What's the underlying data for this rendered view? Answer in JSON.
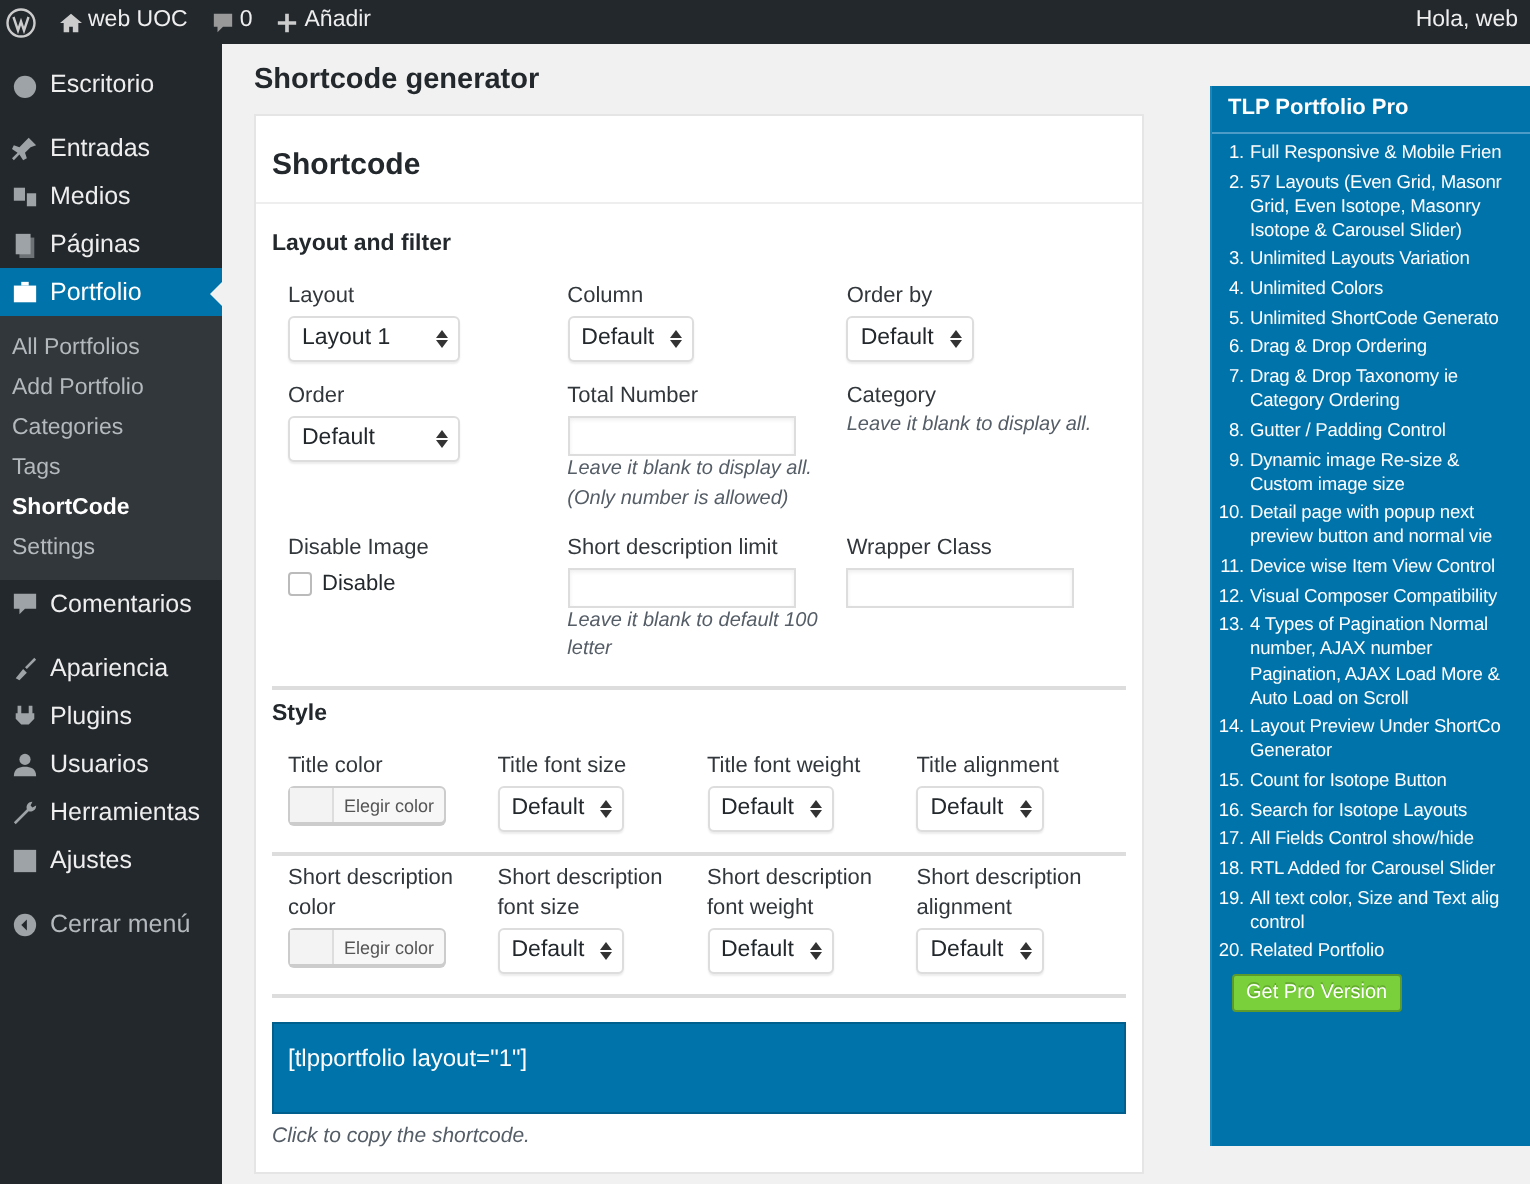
{
  "admin_bar": {
    "site": "web UOC",
    "comments": "0",
    "new": "Añadir",
    "greeting": "Hola, web"
  },
  "sidebar": {
    "groups": [
      [
        {
          "label": "Escritorio",
          "selected": false
        }
      ],
      [
        {
          "label": "Entradas",
          "selected": false
        },
        {
          "label": "Medios",
          "selected": false
        },
        {
          "label": "Páginas",
          "selected": false
        },
        {
          "label": "Portfolio",
          "selected": true,
          "children": [
            {
              "label": "All Portfolios",
              "selected": false
            },
            {
              "label": "Add Portfolio",
              "selected": false
            },
            {
              "label": "Categories",
              "selected": false
            },
            {
              "label": "Tags",
              "selected": false
            },
            {
              "label": "ShortCode",
              "selected": true
            },
            {
              "label": "Settings",
              "selected": false
            }
          ]
        },
        {
          "label": "Comentarios",
          "selected": false
        }
      ],
      [
        {
          "label": "Apariencia",
          "selected": false
        },
        {
          "label": "Plugins",
          "selected": false
        },
        {
          "label": "Usuarios",
          "selected": false
        },
        {
          "label": "Herramientas",
          "selected": false
        },
        {
          "label": "Ajustes",
          "selected": false
        }
      ]
    ],
    "collapse": "Cerrar menú"
  },
  "page_title": "Shortcode generator",
  "card": {
    "title": "Shortcode",
    "sections": [
      {
        "title": "Layout and filter",
        "rows": [
          [
            {
              "label": "Layout",
              "kind": "select",
              "value": "Layout 1"
            },
            {
              "label": "Column",
              "kind": "select",
              "value": "Default"
            },
            {
              "label": "Order by",
              "kind": "select",
              "value": "Default"
            }
          ],
          [
            {
              "label": "Order",
              "kind": "select",
              "value": "Default"
            },
            {
              "label": "Total Number",
              "kind": "text",
              "help": "Leave it blank to display all. (Only number is allowed)"
            },
            {
              "label": "Category",
              "kind": "note",
              "help": "Leave it blank to display all."
            }
          ],
          [
            {
              "label": "Disable Image",
              "kind": "checkbox",
              "option": "Disable",
              "checked": false
            },
            {
              "label": "Short description limit",
              "kind": "text",
              "help": "Leave it blank to default 100 letter"
            },
            {
              "label": "Wrapper Class",
              "kind": "text"
            }
          ]
        ]
      },
      {
        "title": "Style",
        "row_dividers": true,
        "rows": [
          [
            {
              "label": "Title color",
              "kind": "color",
              "value": "Elegir color"
            },
            {
              "label": "Title font size",
              "kind": "select",
              "value": "Default"
            },
            {
              "label": "Title font weight",
              "kind": "select",
              "value": "Default"
            },
            {
              "label": "Title alignment",
              "kind": "select",
              "value": "Default"
            }
          ],
          [
            {
              "label": "Short description color",
              "kind": "color",
              "value": "Elegir color"
            },
            {
              "label": "Short description font size",
              "kind": "select",
              "value": "Default"
            },
            {
              "label": "Short description font weight",
              "kind": "select",
              "value": "Default"
            },
            {
              "label": "Short description alignment",
              "kind": "select",
              "value": "Default"
            }
          ]
        ]
      }
    ],
    "shortcode": "[tlpportfolio layout=\"1\"]",
    "shortcode_hint": "Click to copy the shortcode."
  },
  "pro_panel": {
    "title": "TLP Portfolio Pro",
    "features": [
      {
        "number": "1.",
        "text": "Full Responsive & Mobile Frien"
      },
      {
        "number": "2.",
        "text": "57 Layouts (Even Grid, Masonr Grid, Even Isotope, Masonry Isotope & Carousel Slider)"
      },
      {
        "number": "3.",
        "text": "Unlimited Layouts Variation"
      },
      {
        "number": "4.",
        "text": "Unlimited Colors"
      },
      {
        "number": "5.",
        "text": "Unlimited ShortCode Generato"
      },
      {
        "number": "6.",
        "text": "Drag & Drop Ordering"
      },
      {
        "number": "7.",
        "text": "Drag & Drop Taxonomy ie Category Ordering"
      },
      {
        "number": "8.",
        "text": "Gutter / Padding Control"
      },
      {
        "number": "9.",
        "text": "Dynamic image Re-size & Custom image size"
      },
      {
        "number": "10.",
        "text": "Detail page with popup next preview button and normal vie"
      },
      {
        "number": "11.",
        "text": "Device wise Item View Control"
      },
      {
        "number": "12.",
        "text": "Visual Composer Compatibility"
      },
      {
        "number": "13.",
        "text": "4 Types of Pagination Normal number, AJAX number Pagination, AJAX Load More & Auto Load on Scroll"
      },
      {
        "number": "14.",
        "text": "Layout Preview Under ShortCo Generator"
      },
      {
        "number": "15.",
        "text": "Count for Isotope Button"
      },
      {
        "number": "16.",
        "text": "Search for Isotope Layouts"
      },
      {
        "number": "17.",
        "text": "All Fields Control show/hide"
      },
      {
        "number": "18.",
        "text": "RTL Added for Carousel Slider"
      },
      {
        "number": "19.",
        "text": "All text color, Size and Text alig control"
      },
      {
        "number": "20.",
        "text": "Related Portfolio"
      }
    ],
    "button": "Get Pro Version"
  }
}
